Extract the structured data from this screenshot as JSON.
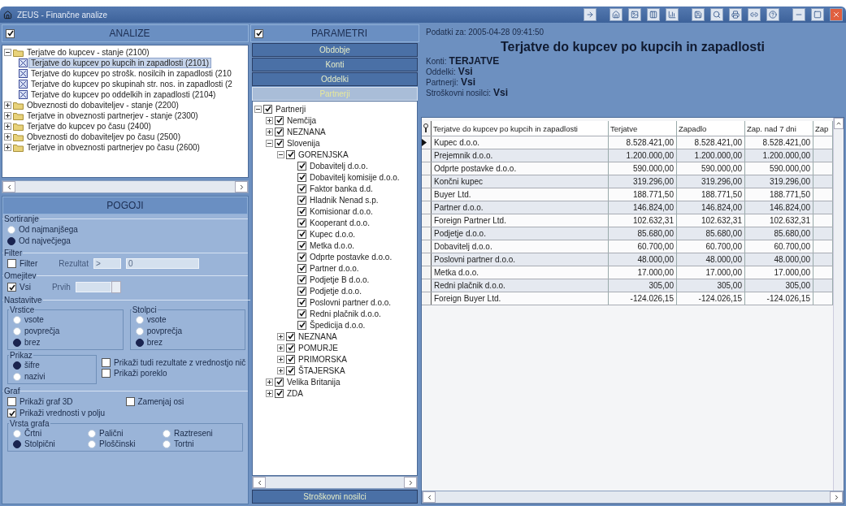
{
  "window": {
    "title": "ZEUS - Finančne analize"
  },
  "analyses": {
    "title": "ANALIZE",
    "checked": true,
    "tree": [
      {
        "label": "Terjatve do kupcev - stanje (2100)",
        "expanded": true,
        "selected": false,
        "children": [
          {
            "label": "Terjatve do kupcev po kupcih in zapadlosti (2101)",
            "selected": true
          },
          {
            "label": "Terjatve do kupcev po strošk. nosilcih in zapadlosti (210",
            "selected": false
          },
          {
            "label": "Terjatve do kupcev po skupinah str. nos. in zapadlosti (2",
            "selected": false
          },
          {
            "label": "Terjatve do kupcev po oddelkih in zapadlosti (2104)",
            "selected": false
          }
        ]
      },
      {
        "label": "Obveznosti do dobaviteljev - stanje (2200)",
        "expanded": false,
        "selected": false
      },
      {
        "label": "Terjatve in obveznosti partnerjev - stanje (2300)",
        "expanded": false,
        "selected": false
      },
      {
        "label": "Terjatve do kupcev po času (2400)",
        "expanded": false,
        "selected": false
      },
      {
        "label": "Obveznosti do dobaviteljev po času (2500)",
        "expanded": false,
        "selected": false
      },
      {
        "label": "Terjatve in obveznosti partnerjev po času (2600)",
        "expanded": false,
        "selected": false
      }
    ]
  },
  "conditions": {
    "title": "POGOJI",
    "sorting": {
      "title": "Sortiranje",
      "options": [
        {
          "label": "Od najmanjšega",
          "selected": false
        },
        {
          "label": "Od največjega",
          "selected": true
        }
      ]
    },
    "filter": {
      "title": "Filter",
      "checkbox": {
        "label": "Filter",
        "checked": false
      },
      "result_label": "Rezultat",
      "operator": ">",
      "value": "0",
      "disabled": true
    },
    "limit": {
      "title": "Omejitev",
      "checkbox": {
        "label": "Vsi",
        "checked": true
      },
      "first_label": "Prvih",
      "disabled": true
    },
    "settings": {
      "title": "Nastavitve",
      "rows": {
        "title": "Vrstice",
        "options": [
          {
            "label": "vsote",
            "selected": false
          },
          {
            "label": "povprečja",
            "selected": false
          },
          {
            "label": "brez",
            "selected": true
          }
        ]
      },
      "columns": {
        "title": "Stolpci",
        "options": [
          {
            "label": "vsote",
            "selected": false
          },
          {
            "label": "povprečja",
            "selected": false
          },
          {
            "label": "brez",
            "selected": true
          }
        ]
      },
      "display": {
        "title": "Prikaz",
        "options": [
          {
            "label": "šifre",
            "selected": true
          },
          {
            "label": "nazivi",
            "selected": false
          }
        ]
      },
      "checkboxes": [
        {
          "label": "Prikaži tudi rezultate z vrednostjo nič",
          "checked": false
        },
        {
          "label": "Prikaži poreklo",
          "checked": false
        }
      ]
    },
    "chart": {
      "title": "Graf",
      "checkboxes": [
        {
          "label": "Prikaži graf 3D",
          "checked": false
        },
        {
          "label": "Zamenjaj osi",
          "checked": false
        },
        {
          "label": "Prikaži vrednosti v polju",
          "checked": true
        }
      ],
      "type": {
        "title": "Vrsta grafa",
        "options": [
          {
            "label": "Črtni",
            "selected": false
          },
          {
            "label": "Palični",
            "selected": false
          },
          {
            "label": "Raztreseni",
            "selected": false
          },
          {
            "label": "Stolpični",
            "selected": true
          },
          {
            "label": "Ploščinski",
            "selected": false
          },
          {
            "label": "Tortni",
            "selected": false
          }
        ]
      }
    }
  },
  "parameters": {
    "title": "PARAMETRI",
    "checked": true,
    "tabs": [
      {
        "label": "Obdobje",
        "selected": false
      },
      {
        "label": "Konti",
        "selected": false
      },
      {
        "label": "Oddelki",
        "selected": false
      },
      {
        "label": "Partnerji",
        "selected": true
      }
    ],
    "tree": [
      {
        "label": "Partnerji",
        "checked": true,
        "expanded": true,
        "children": [
          {
            "label": "Nemčija",
            "checked": true,
            "expanded": false
          },
          {
            "label": "NEZNANA",
            "checked": true,
            "expanded": false
          },
          {
            "label": "Slovenija",
            "checked": true,
            "expanded": true,
            "children": [
              {
                "label": "GORENJSKA",
                "checked": true,
                "expanded": true,
                "children": [
                  {
                    "label": "Dobavitelj d.o.o.",
                    "checked": true
                  },
                  {
                    "label": "Dobavitelj komisije d.o.o.",
                    "checked": true
                  },
                  {
                    "label": "Faktor banka d.d.",
                    "checked": true
                  },
                  {
                    "label": "Hladnik Nenad s.p.",
                    "checked": true
                  },
                  {
                    "label": "Komisionar d.o.o.",
                    "checked": true
                  },
                  {
                    "label": "Kooperant d.o.o.",
                    "checked": true
                  },
                  {
                    "label": "Kupec d.o.o.",
                    "checked": true
                  },
                  {
                    "label": "Metka d.o.o.",
                    "checked": true
                  },
                  {
                    "label": "Odprte postavke d.o.o.",
                    "checked": true
                  },
                  {
                    "label": "Partner d.o.o.",
                    "checked": true
                  },
                  {
                    "label": "Podjetje B d.o.o.",
                    "checked": true
                  },
                  {
                    "label": "Podjetje d.o.o.",
                    "checked": true
                  },
                  {
                    "label": "Poslovni partner d.o.o.",
                    "checked": true
                  },
                  {
                    "label": "Redni plačnik d.o.o.",
                    "checked": true
                  },
                  {
                    "label": "Špedicija d.o.o.",
                    "checked": true
                  }
                ]
              },
              {
                "label": "NEZNANA",
                "checked": true,
                "expanded": false
              },
              {
                "label": "POMURJE",
                "checked": true,
                "expanded": false
              },
              {
                "label": "PRIMORSKA",
                "checked": true,
                "expanded": false
              },
              {
                "label": "ŠTAJERSKA",
                "checked": true,
                "expanded": false
              }
            ]
          },
          {
            "label": "Velika Britanija",
            "checked": true,
            "expanded": false
          },
          {
            "label": "ZDA",
            "checked": true,
            "expanded": false
          }
        ]
      }
    ],
    "bottom_tab": {
      "label": "Stroškovni nosilci",
      "selected": false
    }
  },
  "report": {
    "timestamp": "Podatki za: 2005-04-28 09:41:50",
    "title": "Terjatve do kupcev po kupcih in zapadlosti",
    "info": [
      {
        "label": "Konti:",
        "value": "TERJATVE"
      },
      {
        "label": "Oddelki:",
        "value": "Vsi"
      },
      {
        "label": "Partnerji:",
        "value": "Vsi"
      },
      {
        "label": "Stroškovni nosilci:",
        "value": "Vsi"
      }
    ],
    "table": {
      "columns": [
        "Terjatve do kupcev po kupcih in zapadlosti",
        "Terjatve",
        "Zapadlo",
        "Zap. nad 7 dni",
        "Zap"
      ],
      "rows": [
        {
          "name": "Kupec d.o.o.",
          "values": [
            "8.528.421,00",
            "8.528.421,00",
            "8.528.421,00"
          ],
          "selected": true
        },
        {
          "name": "Prejemnik d.o.o.",
          "values": [
            "1.200.000,00",
            "1.200.000,00",
            "1.200.000,00"
          ],
          "selected": false
        },
        {
          "name": "Odprte postavke d.o.o.",
          "values": [
            "590.000,00",
            "590.000,00",
            "590.000,00"
          ],
          "selected": false
        },
        {
          "name": "Končni kupec",
          "values": [
            "319.296,00",
            "319.296,00",
            "319.296,00"
          ],
          "selected": false
        },
        {
          "name": "Buyer Ltd.",
          "values": [
            "188.771,50",
            "188.771,50",
            "188.771,50"
          ],
          "selected": false
        },
        {
          "name": "Partner d.o.o.",
          "values": [
            "146.824,00",
            "146.824,00",
            "146.824,00"
          ],
          "selected": false
        },
        {
          "name": "Foreign Partner Ltd.",
          "values": [
            "102.632,31",
            "102.632,31",
            "102.632,31"
          ],
          "selected": false
        },
        {
          "name": "Podjetje d.o.o.",
          "values": [
            "85.680,00",
            "85.680,00",
            "85.680,00"
          ],
          "selected": false
        },
        {
          "name": "Dobavitelj d.o.o.",
          "values": [
            "60.700,00",
            "60.700,00",
            "60.700,00"
          ],
          "selected": false
        },
        {
          "name": "Poslovni partner d.o.o.",
          "values": [
            "48.000,00",
            "48.000,00",
            "48.000,00"
          ],
          "selected": false
        },
        {
          "name": "Metka d.o.o.",
          "values": [
            "17.000,00",
            "17.000,00",
            "17.000,00"
          ],
          "selected": false
        },
        {
          "name": "Redni plačnik d.o.o.",
          "values": [
            "305,00",
            "305,00",
            "305,00"
          ],
          "selected": false
        },
        {
          "name": "Foreign Buyer Ltd.",
          "values": [
            "-124.026,15",
            "-124.026,15",
            "-124.026,15"
          ],
          "selected": false
        }
      ]
    }
  }
}
